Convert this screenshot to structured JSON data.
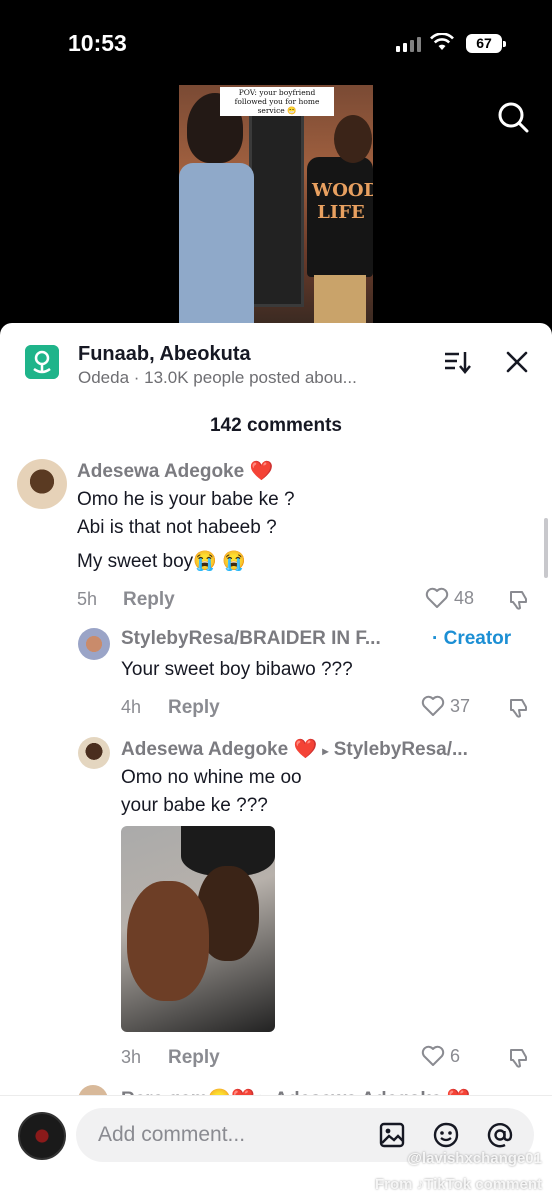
{
  "status": {
    "time": "10:53",
    "battery": "67"
  },
  "video": {
    "caption": "POV: your boyfriend followed you for home service 😁",
    "shirt_text": "WOOD LIFE"
  },
  "header": {
    "location_title": "Funaab, Abeokuta",
    "location_subtitle": "Odeda · 13.0K people posted abou...",
    "comment_count": "142 comments"
  },
  "comments": [
    {
      "user": "Adesewa Adegoke",
      "lines": [
        "Omo he is your babe ke ?",
        "Abi is that not habeeb ?",
        "My sweet boy😭 😭"
      ],
      "time": "5h",
      "reply": "Reply",
      "likes": "48"
    },
    {
      "user": "StylebyResa/BRAIDER IN F...",
      "badge": "· Creator",
      "lines": [
        "Your sweet boy bibawo ???"
      ],
      "time": "4h",
      "reply": "Reply",
      "likes": "37"
    },
    {
      "user": "Adesewa Adegoke",
      "reply_to": "StylebyResa/...",
      "lines": [
        "Omo no whine me oo",
        "your babe ke ???"
      ],
      "time": "3h",
      "reply": "Reply",
      "likes": "6"
    }
  ],
  "partial_comment": {
    "user": "Rere gem😊❤️ ▸ Adesewa Adegoke ❤️"
  },
  "composer": {
    "placeholder": "Add comment..."
  },
  "watermark": {
    "handle": "@lavishxchange01",
    "source": "From ♪TikTok comment"
  },
  "colors": {
    "accent_blue": "#1c8fd4",
    "location_green": "#1fb48a",
    "heart": "#e0245e"
  }
}
